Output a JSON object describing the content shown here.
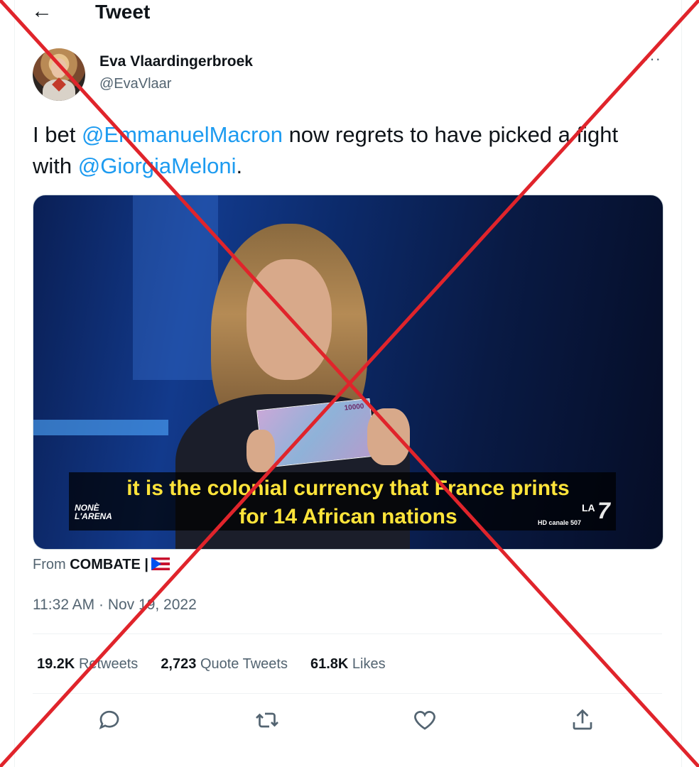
{
  "header": {
    "back_icon": "←",
    "title": "Tweet"
  },
  "author": {
    "name": "Eva Vlaardingerbroek",
    "handle": "@EvaVlaar",
    "more_icon": "···"
  },
  "tweet": {
    "text_part1": "I bet ",
    "mention1": "@EmmanuelMacron",
    "text_part2": " now regrets to have picked a fight with ",
    "mention2": "@GiorgiaMeloni",
    "text_part3": "."
  },
  "media": {
    "subtitle_line1": "it is the colonial currency that France prints",
    "subtitle_line2": "for 14 African nations",
    "show_logo_line1": "NONÈ",
    "show_logo_line2": "L'ARENA",
    "channel_logo_la": "LA",
    "channel_logo_num": "7",
    "channel_info": "HD canale 507",
    "banknote_value": "10000"
  },
  "source": {
    "prefix": "From",
    "name": "COMBATE |"
  },
  "timestamp": "11:32 AM · Nov 19, 2022",
  "stats": {
    "retweets_count": "19.2K",
    "retweets_label": "Retweets",
    "quotes_count": "2,723",
    "quotes_label": "Quote Tweets",
    "likes_count": "61.8K",
    "likes_label": "Likes"
  },
  "colors": {
    "mention": "#1d9bf0",
    "cross": "#e0242b",
    "subtitle": "#ffe43a"
  }
}
